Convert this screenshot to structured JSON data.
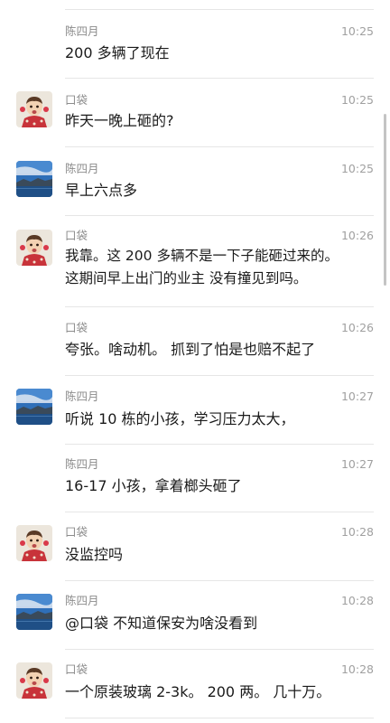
{
  "messages": [
    {
      "sender": "陈四月",
      "time": "10:25",
      "avatar": "landscape-avatar",
      "show_avatar": false,
      "lines": [
        "200 多辆了现在"
      ]
    },
    {
      "sender": "口袋",
      "time": "10:25",
      "avatar": "child-avatar",
      "show_avatar": true,
      "lines": [
        "昨天一晚上砸的?"
      ]
    },
    {
      "sender": "陈四月",
      "time": "10:25",
      "avatar": "landscape-avatar",
      "show_avatar": true,
      "lines": [
        "早上六点多"
      ]
    },
    {
      "sender": "口袋",
      "time": "10:26",
      "avatar": "child-avatar",
      "show_avatar": true,
      "lines": [
        "我靠。这 200 多辆不是一下子能砸过来的。",
        "这期间早上出门的业主 没有撞见到吗。"
      ]
    },
    {
      "sender": "口袋",
      "time": "10:26",
      "avatar": "child-avatar",
      "show_avatar": false,
      "lines": [
        "夸张。啥动机。 抓到了怕是也赔不起了"
      ]
    },
    {
      "sender": "陈四月",
      "time": "10:27",
      "avatar": "landscape-avatar",
      "show_avatar": true,
      "lines": [
        "听说 10 栋的小孩，学习压力太大，"
      ]
    },
    {
      "sender": "陈四月",
      "time": "10:27",
      "avatar": "landscape-avatar",
      "show_avatar": false,
      "lines": [
        "16-17 小孩，拿着榔头砸了"
      ]
    },
    {
      "sender": "口袋",
      "time": "10:28",
      "avatar": "child-avatar",
      "show_avatar": true,
      "lines": [
        "没监控吗"
      ]
    },
    {
      "sender": "陈四月",
      "time": "10:28",
      "avatar": "landscape-avatar",
      "show_avatar": true,
      "lines": [
        "@口袋 不知道保安为啥没看到"
      ]
    },
    {
      "sender": "口袋",
      "time": "10:28",
      "avatar": "child-avatar",
      "show_avatar": true,
      "lines": [
        "一个原装玻璃 2-3k。 200 两。 几十万。"
      ]
    }
  ]
}
